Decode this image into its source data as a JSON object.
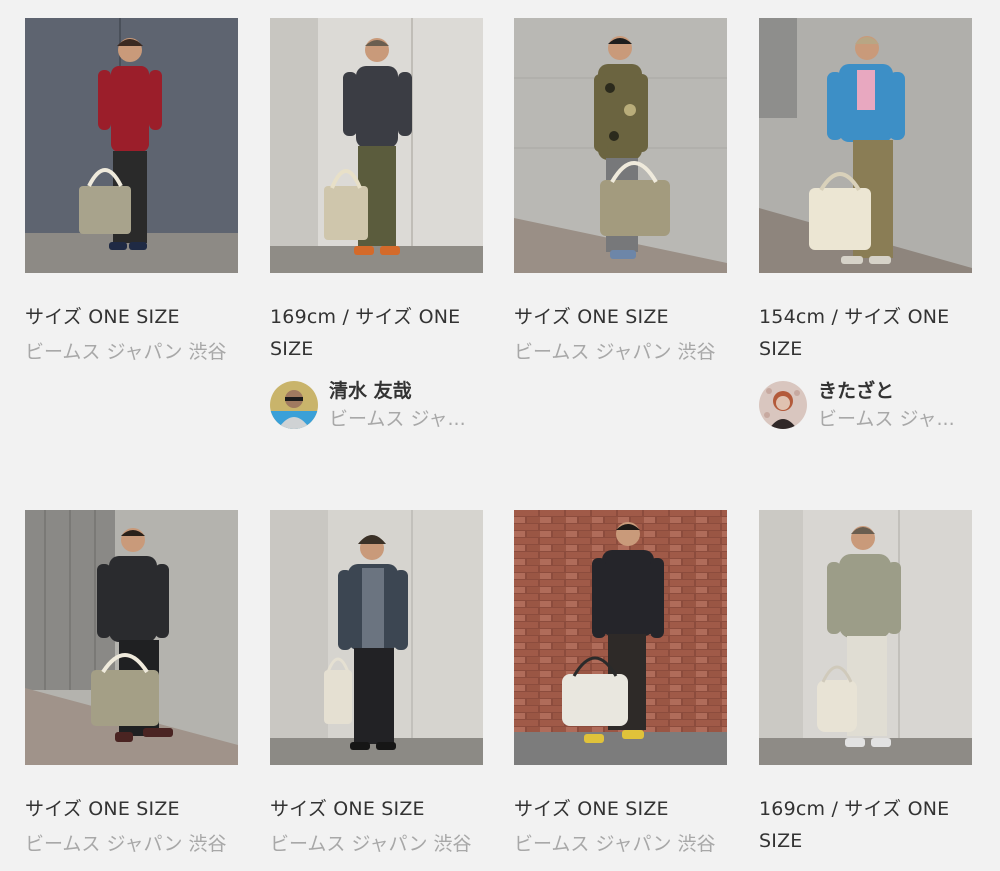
{
  "cards": [
    {
      "size_text": "サイズ ONE SIZE",
      "shop": "ビームス ジャパン 渋谷",
      "icon": "outfit-photo",
      "colors": {
        "bg": "#5e6470",
        "floor": "#8d8a85",
        "top": "#9b1e2a",
        "bottom": "#2a2a2a",
        "bag": "#a8a38c",
        "hair": "#3b2a22"
      }
    },
    {
      "size_text": "169cm / サイズ ONE SIZE",
      "icon": "outfit-photo",
      "staff": {
        "name": "清水 友哉",
        "shop": "ビームス ジャ..."
      },
      "colors": {
        "bg": "#dcdad6",
        "floor": "#8f8c86",
        "top": "#3b3d44",
        "bottom": "#5b5c3d",
        "bag": "#cfc6ac",
        "hair": "#6a5e50"
      }
    },
    {
      "size_text": "サイズ ONE SIZE",
      "shop": "ビームス ジャパン 渋谷",
      "icon": "outfit-photo",
      "colors": {
        "bg": "#b9b8b4",
        "floor": "#9a8f86",
        "top": "#6b6440",
        "bottom": "#77787a",
        "bag": "#a39b7e",
        "hair": "#1e1e1e"
      }
    },
    {
      "size_text": "154cm / サイズ ONE SIZE",
      "icon": "outfit-photo",
      "staff": {
        "name": "きたざと",
        "shop": "ビームス ジャ..."
      },
      "colors": {
        "bg": "#b0afab",
        "floor": "#8e857d",
        "top": "#3d8fc6",
        "bottom": "#8a7d55",
        "bag": "#ece6d3",
        "hair": "#b8a684"
      }
    },
    {
      "size_text": "サイズ ONE SIZE",
      "shop": "ビームス ジャパン 渋谷",
      "icon": "outfit-photo",
      "colors": {
        "bg": "#b4b3ae",
        "floor": "#a0938a",
        "top": "#2a2b2e",
        "bottom": "#1f2022",
        "bag": "#a49f86",
        "hair": "#2a211a"
      }
    },
    {
      "size_text": "サイズ ONE SIZE",
      "shop": "ビームス ジャパン 渋谷",
      "icon": "outfit-photo",
      "colors": {
        "bg": "#d6d4cf",
        "floor": "#8c8a85",
        "top": "#3c4652",
        "bottom": "#222225",
        "bag": "#e5e0d2",
        "hair": "#3b3127"
      }
    },
    {
      "size_text": "サイズ ONE SIZE",
      "shop": "ビームス ジャパン 渋谷",
      "icon": "outfit-photo",
      "colors": {
        "bg": "#8c4c3d",
        "floor": "#7c7c7c",
        "top": "#25252a",
        "bottom": "#2e2a28",
        "bag": "#e9e7df",
        "hair": "#1e1a17"
      }
    },
    {
      "size_text": "169cm / サイズ ONE SIZE",
      "icon": "outfit-photo",
      "colors": {
        "bg": "#d8d6d2",
        "floor": "#8e8b86",
        "top": "#9c9d88",
        "bottom": "#e0ddd3",
        "bag": "#e8e3d5",
        "hair": "#6a5e50"
      }
    }
  ],
  "avatars": {
    "staff-1": {
      "icon": "staff-avatar",
      "colors": {
        "bg": "#c9b46b",
        "face": "#a07a60",
        "shirt": "#cfd2d4"
      }
    },
    "staff-2": {
      "icon": "staff-avatar",
      "colors": {
        "bg": "#d9c6bf",
        "face": "#e0c2b0",
        "shirt": "#302828"
      }
    }
  }
}
